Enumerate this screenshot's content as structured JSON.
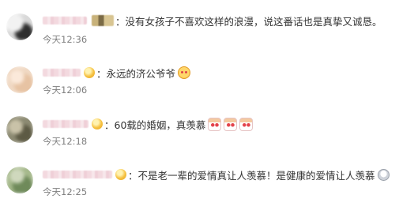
{
  "comments": [
    {
      "text": "：没有女孩子不喜欢这样的浪漫，说这番话也是真挚又诚恳。",
      "time": "今天12:36",
      "emojis": [],
      "badge": "square-badge",
      "avatar_colors": [
        "#e8e8e8",
        "#3b3b3b",
        "#c9302c"
      ]
    },
    {
      "text": "：永远的济公爷爷",
      "time": "今天12:06",
      "emojis": [
        "kiss-face-icon"
      ],
      "badge": "gold-badge",
      "avatar_colors": [
        "#f0d9c4",
        "#e7c3a3",
        "#fbe9da"
      ]
    },
    {
      "text": "：60载的婚姻，真羡慕",
      "time": "今天12:18",
      "emojis": [
        "envy-icon",
        "envy-icon",
        "envy-icon"
      ],
      "badge": "gold-badge",
      "avatar_colors": [
        "#8c8a72",
        "#c9c2a8",
        "#5d5a44"
      ]
    },
    {
      "text": "：不是老一辈的爱情真让人羡慕！是健康的爱情让人羡慕",
      "time": "今天12:25",
      "emojis": [
        "crying-ghost-icon"
      ],
      "badge": "gold-badge",
      "avatar_colors": [
        "#6f8a5a",
        "#a6b98c",
        "#cfd8bd"
      ]
    }
  ]
}
